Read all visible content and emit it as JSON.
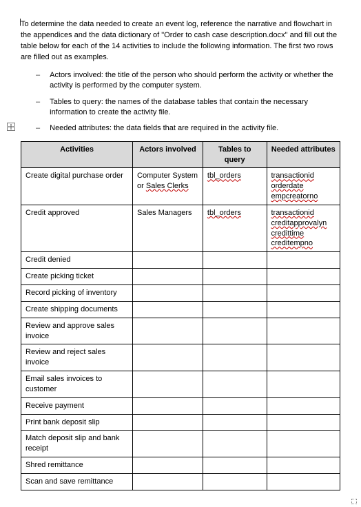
{
  "intro": "To determine the data needed to create an event log, reference the narrative and flowchart in the appendices and the data dictionary of \"Order to cash case description.docx\" and fill out the table below for each of the 14 activities to include the following information. The first two rows are filled out as examples.",
  "bullets": [
    "Actors involved: the title of the person who should perform the activity or whether the activity is performed by the computer system.",
    "Tables to query: the names of the database tables that contain the necessary information to create the activity file.",
    "Needed attributes: the data fields that are required in the activity file."
  ],
  "headers": {
    "c1": "Activities",
    "c2": "Actors involved",
    "c3": "Tables to query",
    "c4": "Needed attributes"
  },
  "chart_data": {
    "type": "table",
    "columns": [
      "Activities",
      "Actors involved",
      "Tables to query",
      "Needed attributes"
    ],
    "rows": [
      {
        "activity": "Create digital purchase order",
        "actors_plain": "Computer System or ",
        "actors_wavy": "Sales Clerks",
        "tables": [
          "tbl_orders"
        ],
        "attributes": [
          "transactionid",
          "orderdate",
          "empcreatorno"
        ]
      },
      {
        "activity": "Credit approved",
        "actors_plain": "Sales Managers",
        "actors_wavy": "",
        "tables": [
          "tbl_orders"
        ],
        "attributes": [
          "transactionid",
          "creditapprovalyn",
          "credittime",
          "creditempno"
        ]
      },
      {
        "activity": "Credit denied",
        "actors_plain": "",
        "actors_wavy": "",
        "tables": [],
        "attributes": []
      },
      {
        "activity": "Create picking ticket",
        "actors_plain": "",
        "actors_wavy": "",
        "tables": [],
        "attributes": []
      },
      {
        "activity": "Record picking of inventory",
        "actors_plain": "",
        "actors_wavy": "",
        "tables": [],
        "attributes": []
      },
      {
        "activity": "Create shipping documents",
        "actors_plain": "",
        "actors_wavy": "",
        "tables": [],
        "attributes": []
      },
      {
        "activity": "Review and approve sales invoice",
        "actors_plain": "",
        "actors_wavy": "",
        "tables": [],
        "attributes": []
      },
      {
        "activity": "Review and reject sales invoice",
        "actors_plain": "",
        "actors_wavy": "",
        "tables": [],
        "attributes": []
      },
      {
        "activity": "Email sales invoices to customer",
        "actors_plain": "",
        "actors_wavy": "",
        "tables": [],
        "attributes": []
      },
      {
        "activity": "Receive payment",
        "actors_plain": "",
        "actors_wavy": "",
        "tables": [],
        "attributes": []
      },
      {
        "activity": "Print bank deposit slip",
        "actors_plain": "",
        "actors_wavy": "",
        "tables": [],
        "attributes": []
      },
      {
        "activity": "Match deposit slip and bank receipt",
        "actors_plain": "",
        "actors_wavy": "",
        "tables": [],
        "attributes": []
      },
      {
        "activity": "Shred remittance",
        "actors_plain": "",
        "actors_wavy": "",
        "tables": [],
        "attributes": []
      },
      {
        "activity": "Scan and save remittance",
        "actors_plain": "",
        "actors_wavy": "",
        "tables": [],
        "attributes": []
      }
    ]
  }
}
